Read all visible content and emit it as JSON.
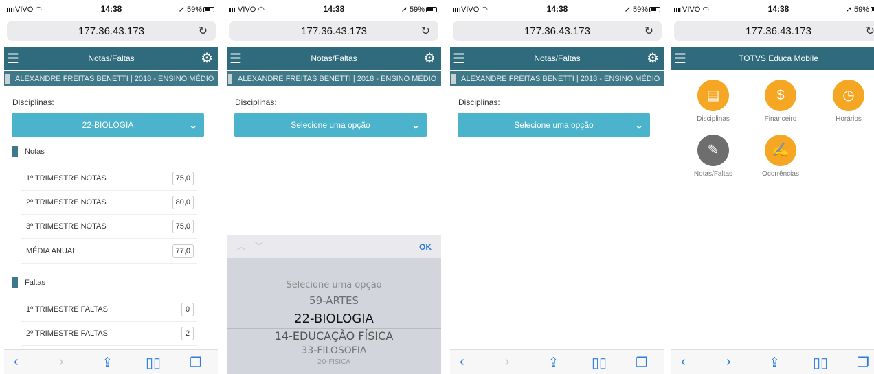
{
  "status": {
    "carrier": "VIVO",
    "time": "14:38",
    "battery": "59%"
  },
  "browser": {
    "url": "177.36.43.173"
  },
  "header": {
    "title_notas": "Notas/Faltas",
    "title_home": "TOTVS Educa Mobile"
  },
  "student_line": "ALEXANDRE FREITAS BENETTI | 2018 - ENSINO MÉDIO",
  "disciplinas_label": "Disciplinas:",
  "select": {
    "selected": "22-BIOLOGIA",
    "placeholder": "Selecione uma opção"
  },
  "notas": {
    "section": "Notas",
    "rows": [
      {
        "label": "1º TRIMESTRE NOTAS",
        "value": "75,0"
      },
      {
        "label": "2º TRIMESTRE NOTAS",
        "value": "80,0"
      },
      {
        "label": "3º TRIMESTRE NOTAS",
        "value": "75,0"
      },
      {
        "label": "MÉDIA ANUAL",
        "value": "77,0"
      }
    ]
  },
  "faltas": {
    "section": "Faltas",
    "rows": [
      {
        "label": "1º TRIMESTRE FALTAS",
        "value": "0"
      },
      {
        "label": "2º TRIMESTRE FALTAS",
        "value": "2"
      }
    ]
  },
  "picker": {
    "ok": "OK",
    "options": [
      "Selecione uma opção",
      "59-ARTES",
      "22-BIOLOGIA",
      "14-EDUCAÇÃO FÍSICA",
      "33-FILOSOFIA",
      "20-FÍSICA"
    ]
  },
  "home_menu": [
    {
      "label": "Disciplinas",
      "icon": "document-icon"
    },
    {
      "label": "Financeiro",
      "icon": "dollar-icon"
    },
    {
      "label": "Horários",
      "icon": "clock-icon"
    },
    {
      "label": "Notas/Faltas",
      "icon": "grades-icon"
    },
    {
      "label": "Ocorrências",
      "icon": "clipboard-edit-icon"
    }
  ],
  "colors": {
    "header": "#2f6b7c",
    "select": "#4bb3cc",
    "menu_orange": "#f5a623",
    "menu_gray": "#6e6e6e",
    "link_blue": "#2a7de1"
  }
}
